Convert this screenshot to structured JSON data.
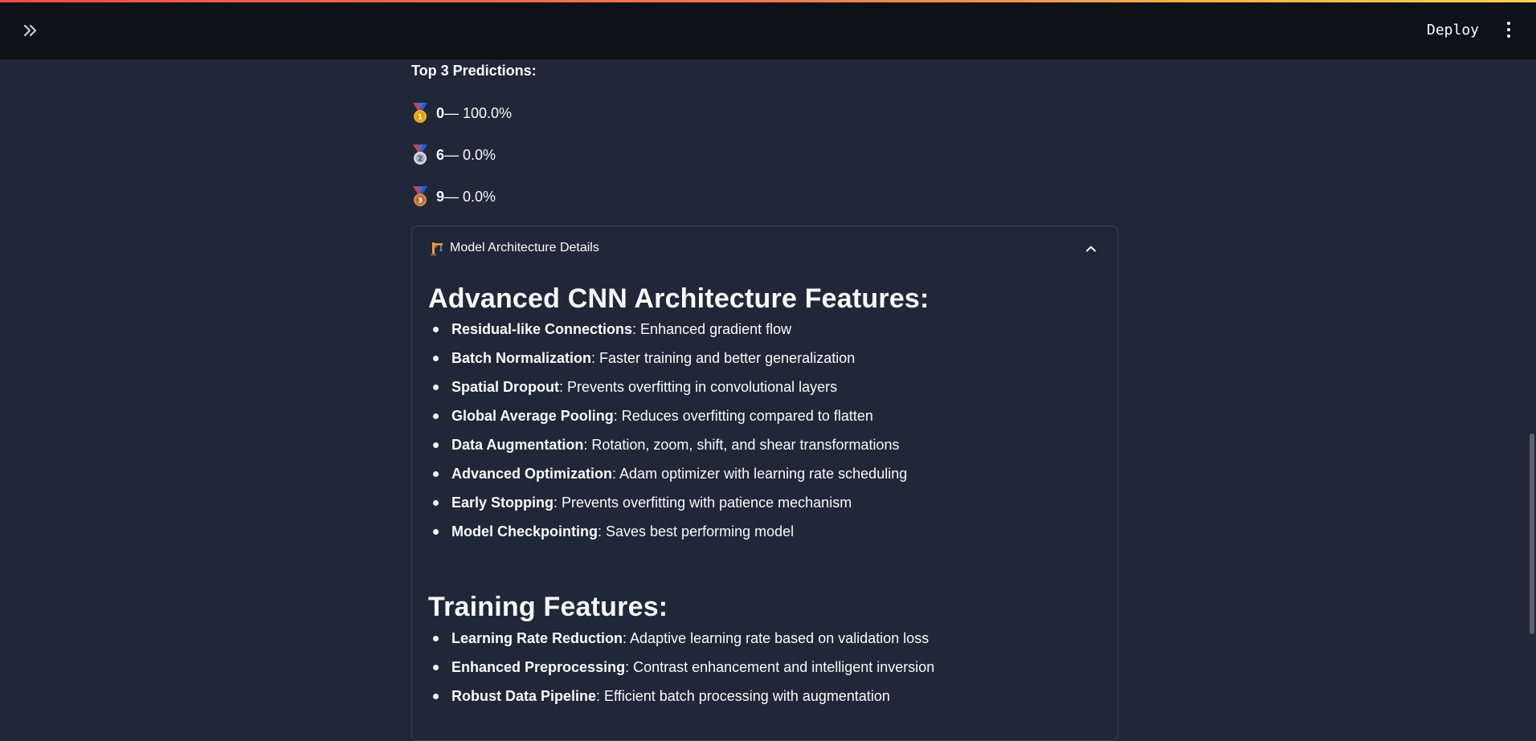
{
  "header": {
    "deploy_label": "Deploy",
    "expand_icon": "double-chevron-right-icon",
    "menu_icon": "kebab-menu-icon",
    "accent_gradient": [
      "#ff4b4b",
      "#ffd54b"
    ]
  },
  "predictions": {
    "title": "Top 3 Predictions:",
    "items": [
      {
        "medal": "gold-medal-icon",
        "digit": "0",
        "text": " — 100.0%"
      },
      {
        "medal": "silver-medal-icon",
        "digit": "6",
        "text": " — 0.0%"
      },
      {
        "medal": "bronze-medal-icon",
        "digit": "9",
        "text": " — 0.0%"
      }
    ]
  },
  "expander": {
    "icon": "construction-icon",
    "title": "Model Architecture Details",
    "state": "expanded",
    "sections": [
      {
        "heading": "Advanced CNN Architecture Features:",
        "items": [
          {
            "term": "Residual-like Connections",
            "desc": ": Enhanced gradient flow"
          },
          {
            "term": "Batch Normalization",
            "desc": ": Faster training and better generalization"
          },
          {
            "term": "Spatial Dropout",
            "desc": ": Prevents overfitting in convolutional layers"
          },
          {
            "term": "Global Average Pooling",
            "desc": ": Reduces overfitting compared to flatten"
          },
          {
            "term": "Data Augmentation",
            "desc": ": Rotation, zoom, shift, and shear transformations"
          },
          {
            "term": "Advanced Optimization",
            "desc": ": Adam optimizer with learning rate scheduling"
          },
          {
            "term": "Early Stopping",
            "desc": ": Prevents overfitting with patience mechanism"
          },
          {
            "term": "Model Checkpointing",
            "desc": ": Saves best performing model"
          }
        ]
      },
      {
        "heading": "Training Features:",
        "items": [
          {
            "term": "Learning Rate Reduction",
            "desc": ": Adaptive learning rate based on validation loss"
          },
          {
            "term": "Enhanced Preprocessing",
            "desc": ": Contrast enhancement and intelligent inversion"
          },
          {
            "term": "Robust Data Pipeline",
            "desc": ": Efficient batch processing with augmentation"
          }
        ]
      }
    ]
  }
}
